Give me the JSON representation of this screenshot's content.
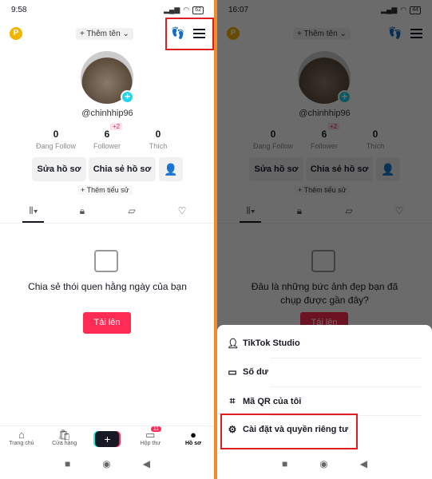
{
  "profile": {
    "p_badge": "P",
    "add_name": "+ Thêm tên ⌄",
    "username": "@chinhhip96",
    "follower_delta": "+2",
    "stats": [
      {
        "value": "0",
        "label": "Đang Follow"
      },
      {
        "value": "6",
        "label": "Follower"
      },
      {
        "value": "0",
        "label": "Thích"
      }
    ],
    "edit_profile": "Sửa hồ sơ",
    "share_profile": "Chia sẻ hồ sơ",
    "add_bio": "+ Thêm tiểu sử",
    "upload": "Tải lên"
  },
  "left": {
    "status_time": "9:58",
    "battery": "62",
    "empty_text": "Chia sẻ thói quen hằng ngày của bạn"
  },
  "right": {
    "status_time": "16:07",
    "battery": "44",
    "empty_text": "Đâu là những bức ảnh đẹp bạn đã chụp được gần đây?"
  },
  "nav": {
    "items": [
      "Trang chủ",
      "Cửa hàng",
      "",
      "Hộp thư",
      "Hồ sơ"
    ],
    "inbox_badge": "11"
  },
  "sheet": {
    "items": [
      "TikTok Studio",
      "Số dư",
      "Mã QR của tôi",
      "Cài đặt và quyền riêng tư"
    ]
  },
  "colors": {
    "accent": "#fe2c55",
    "highlight": "#e02020",
    "divider": "#f28c28"
  }
}
